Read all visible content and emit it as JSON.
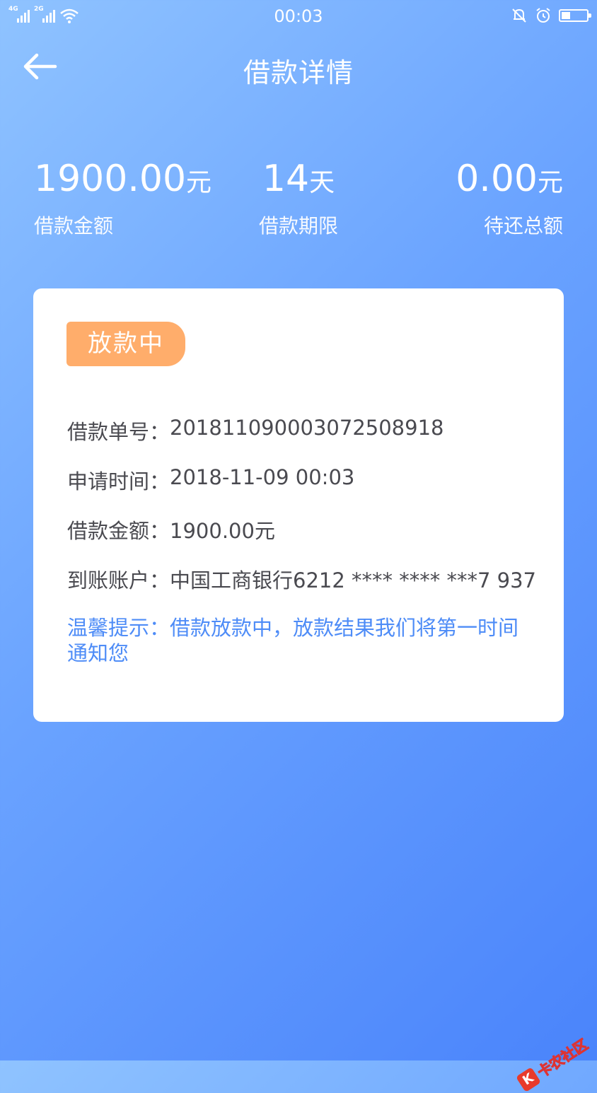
{
  "status_bar": {
    "time": "00:03",
    "sim1_label": "4G",
    "sim2_label": "2G",
    "icons": [
      "signal-4g-icon",
      "signal-2g-icon",
      "wifi-icon",
      "silent-bell-icon",
      "alarm-icon",
      "battery-icon"
    ],
    "battery_level": 0.3
  },
  "nav": {
    "title": "借款详情",
    "back_icon": "arrow-left-icon"
  },
  "summary": {
    "amount": {
      "value": "1900.00",
      "unit": "元",
      "label": "借款金额"
    },
    "term": {
      "value": "14",
      "unit": "天",
      "label": "借款期限"
    },
    "outstanding": {
      "value": "0.00",
      "unit": "元",
      "label": "待还总额"
    }
  },
  "detail": {
    "status_badge": "放款中",
    "rows": [
      {
        "label": "借款单号：",
        "value": "201811090003072508918"
      },
      {
        "label": "申请时间：",
        "value": "2018-11-09 00:03"
      },
      {
        "label": "借款金额：",
        "value": "1900.00元"
      },
      {
        "label": "到账账户：",
        "value": "中国工商银行6212 **** **** ***7 937"
      }
    ],
    "tip": "温馨提示：借款放款中，放款结果我们将第一时间通知您"
  },
  "watermark": {
    "text": "卡农社区",
    "logo": "K"
  },
  "colors": {
    "bg_start": "#8fc3ff",
    "bg_end": "#4a84fb",
    "badge": "#ffad6b",
    "tip": "#4e8cf7",
    "text": "#4a4a50"
  }
}
